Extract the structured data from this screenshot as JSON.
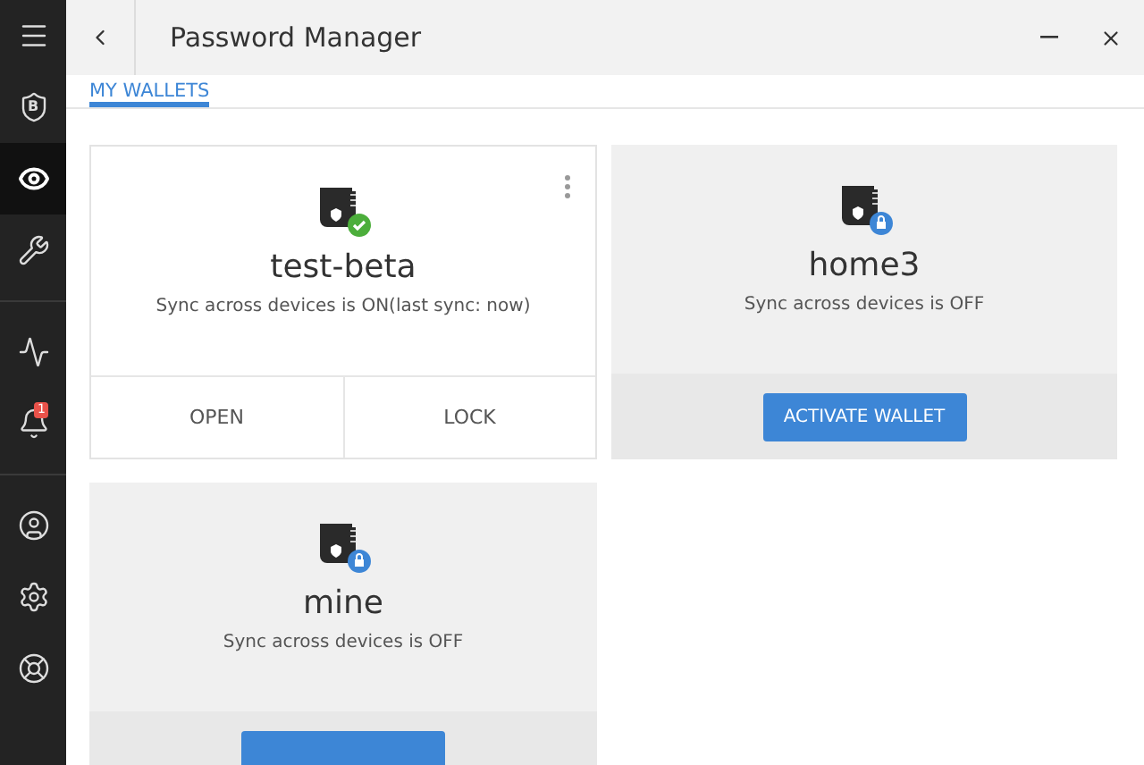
{
  "sidebar": {
    "logo_letter": "B",
    "items": [
      {
        "kind": "menu",
        "selected": false
      },
      {
        "kind": "shield",
        "selected": false
      },
      {
        "kind": "eye",
        "selected": true
      },
      {
        "kind": "tools",
        "selected": false
      },
      {
        "kind": "divider"
      },
      {
        "kind": "chart",
        "selected": false
      },
      {
        "kind": "bell",
        "selected": false,
        "badge": "1"
      },
      {
        "kind": "divider"
      },
      {
        "kind": "user",
        "selected": false
      },
      {
        "kind": "gear",
        "selected": false
      },
      {
        "kind": "lifebuoy",
        "selected": false
      }
    ]
  },
  "header": {
    "title": "Password Manager"
  },
  "tabs": [
    {
      "label": "MY WALLETS",
      "selected": true
    }
  ],
  "wallets": [
    {
      "name": "test-beta",
      "kind": "unlocked",
      "sync": "Sync across devices is ON(last sync: now)",
      "actions": [
        "OPEN",
        "LOCK"
      ]
    },
    {
      "name": "home3",
      "kind": "locked",
      "sync": "Sync across devices is OFF",
      "button": "ACTIVATE WALLET"
    },
    {
      "name": "mine",
      "kind": "locked",
      "sync": "Sync across devices is OFF"
    }
  ]
}
